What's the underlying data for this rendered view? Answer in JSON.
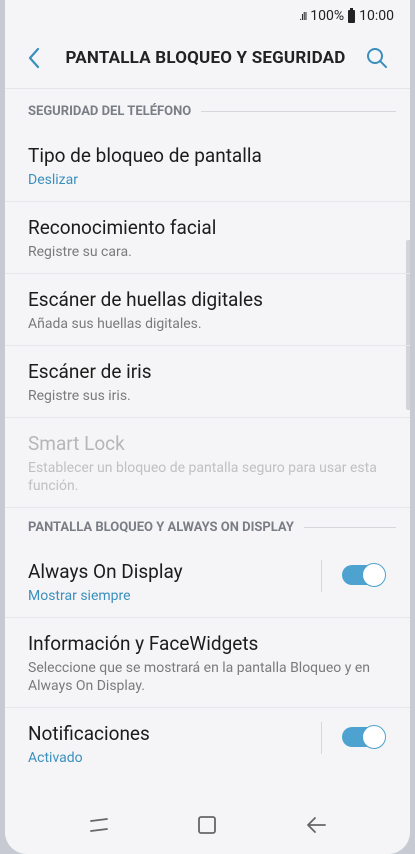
{
  "status": {
    "signal": ".ıll",
    "battery": "100%",
    "time": "10:00"
  },
  "header": {
    "title": "PANTALLA BLOQUEO Y SEGURIDAD"
  },
  "sections": [
    {
      "title": "SEGURIDAD DEL TELÉFONO",
      "items": [
        {
          "title": "Tipo de bloqueo de pantalla",
          "subtitle": "Deslizar"
        },
        {
          "title": "Reconocimiento facial",
          "subtitle": "Registre su cara."
        },
        {
          "title": "Escáner de huellas digitales",
          "subtitle": "Añada sus huellas digitales."
        },
        {
          "title": "Escáner de iris",
          "subtitle": "Registre sus iris."
        },
        {
          "title": "Smart Lock",
          "subtitle": "Establecer un bloqueo de pantalla seguro para usar esta función."
        }
      ]
    },
    {
      "title": "PANTALLA BLOQUEO Y ALWAYS ON DISPLAY",
      "items": [
        {
          "title": "Always On Display",
          "subtitle": "Mostrar siempre",
          "toggle": true
        },
        {
          "title": "Información y FaceWidgets",
          "subtitle": "Seleccione que se mostrará en la pantalla Bloqueo y en Always On Display."
        },
        {
          "title": "Notificaciones",
          "subtitle": "Activado",
          "toggle": true
        }
      ]
    }
  ],
  "colors": {
    "accent": "#3a8fbd",
    "toggle_on": "#4da2cf"
  },
  "icons": {
    "back": "chevron-left-icon",
    "search": "search-icon",
    "recents": "recents-icon",
    "home": "home-icon",
    "nav_back": "back-arrow-icon"
  }
}
